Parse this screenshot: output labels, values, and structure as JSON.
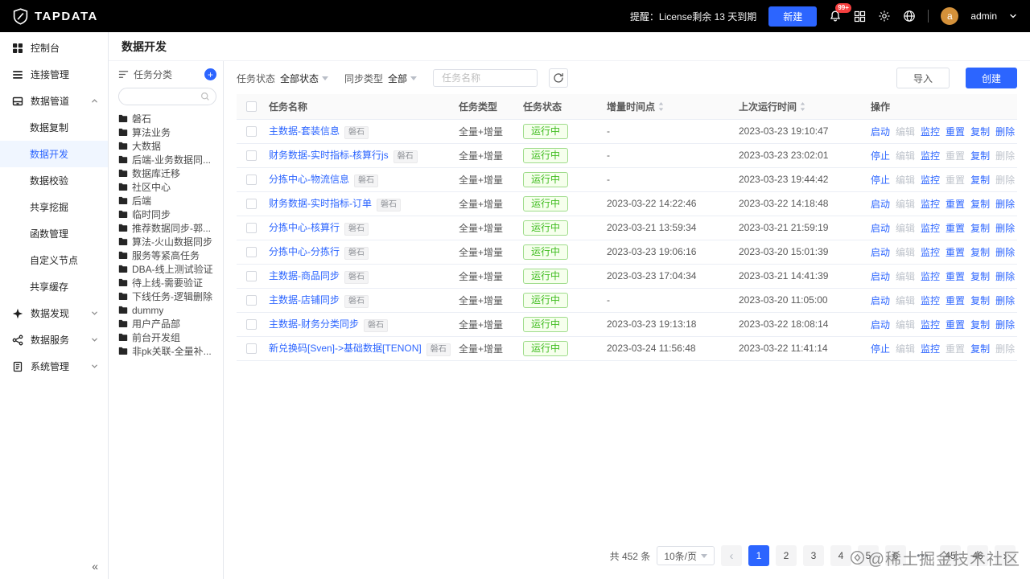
{
  "topbar": {
    "brand": "TAPDATA",
    "license_notice": "提醒：License剩余 13 天到期",
    "new_button": "新建",
    "notification_count": "99+",
    "username": "admin",
    "avatar_letter": "a"
  },
  "colors": {
    "primary": "#2c65ff",
    "success": "#3fbc1f",
    "topbar_bg": "#000000",
    "avatar_bg": "#d4913a",
    "notification_badge_bg": "#f53f3f"
  },
  "page": {
    "title": "数据开发"
  },
  "sidebar": {
    "collapse_icon": "«",
    "items": [
      {
        "id": "console",
        "label": "控制台",
        "icon": "dashboard-icon"
      },
      {
        "id": "connections",
        "label": "连接管理",
        "icon": "connections-icon"
      },
      {
        "id": "data-pipeline",
        "label": "数据管道",
        "icon": "pipeline-icon",
        "expanded": true,
        "children": [
          {
            "id": "data-replication",
            "label": "数据复制"
          },
          {
            "id": "data-development",
            "label": "数据开发",
            "active": true
          },
          {
            "id": "data-validation",
            "label": "数据校验"
          },
          {
            "id": "shared-mining",
            "label": "共享挖掘"
          },
          {
            "id": "function-management",
            "label": "函数管理"
          },
          {
            "id": "custom-node",
            "label": "自定义节点"
          },
          {
            "id": "shared-cache",
            "label": "共享缓存"
          }
        ]
      },
      {
        "id": "data-discovery",
        "label": "数据发现",
        "icon": "discovery-icon",
        "expandable": true
      },
      {
        "id": "data-service",
        "label": "数据服务",
        "icon": "services-icon",
        "expandable": true
      },
      {
        "id": "system-management",
        "label": "系统管理",
        "icon": "system-icon",
        "expandable": true
      }
    ]
  },
  "tree_panel": {
    "title": "任务分类",
    "search_placeholder": "",
    "items": [
      "磐石",
      "算法业务",
      "大数据",
      "后端-业务数据同...",
      "数据库迁移",
      "社区中心",
      "后端",
      "临时同步",
      "推荐数据同步-郭...",
      "算法-火山数据同步",
      "服务等紧高任务",
      "DBA-线上测试验证",
      "待上线-需要验证",
      "下线任务-逻辑删除",
      "dummy",
      "用户产品部",
      "前台开发组",
      "非pk关联-全量补..."
    ]
  },
  "filters": {
    "status_label": "任务状态",
    "status_value": "全部状态",
    "sync_type_label": "同步类型",
    "sync_type_value": "全部",
    "search_placeholder": "任务名称"
  },
  "actions": {
    "import": "导入",
    "create": "创建"
  },
  "table": {
    "columns": [
      {
        "label": "任务名称"
      },
      {
        "label": "任务类型"
      },
      {
        "label": "任务状态"
      },
      {
        "label": "增量时间点",
        "sortable": true
      },
      {
        "label": "上次运行时间",
        "sortable": true
      },
      {
        "label": "操作"
      }
    ],
    "rows": [
      {
        "name": "主数据-套装信息",
        "tag": "磐石",
        "type": "全量+增量",
        "status": "运行中",
        "increment_time": "-",
        "last_run_time": "2023-03-23 19:10:47",
        "ops": [
          {
            "id": "start",
            "label": "启动",
            "enabled": true
          },
          {
            "id": "edit",
            "label": "编辑",
            "enabled": false
          },
          {
            "id": "monitor",
            "label": "监控",
            "enabled": true
          },
          {
            "id": "reset",
            "label": "重置",
            "enabled": true
          },
          {
            "id": "copy",
            "label": "复制",
            "enabled": true
          },
          {
            "id": "delete",
            "label": "删除",
            "enabled": true
          }
        ]
      },
      {
        "name": "财务数据-实时指标-核算行js",
        "tag": "磐石",
        "type": "全量+增量",
        "status": "运行中",
        "increment_time": "-",
        "last_run_time": "2023-03-23 23:02:01",
        "ops": [
          {
            "id": "stop",
            "label": "停止",
            "enabled": true
          },
          {
            "id": "edit",
            "label": "编辑",
            "enabled": false
          },
          {
            "id": "monitor",
            "label": "监控",
            "enabled": true
          },
          {
            "id": "reset",
            "label": "重置",
            "enabled": false
          },
          {
            "id": "copy",
            "label": "复制",
            "enabled": true
          },
          {
            "id": "delete",
            "label": "删除",
            "enabled": false
          }
        ]
      },
      {
        "name": "分拣中心-物流信息",
        "tag": "磐石",
        "type": "全量+增量",
        "status": "运行中",
        "increment_time": "-",
        "last_run_time": "2023-03-23 19:44:42",
        "ops": [
          {
            "id": "stop",
            "label": "停止",
            "enabled": true
          },
          {
            "id": "edit",
            "label": "编辑",
            "enabled": false
          },
          {
            "id": "monitor",
            "label": "监控",
            "enabled": true
          },
          {
            "id": "reset",
            "label": "重置",
            "enabled": false
          },
          {
            "id": "copy",
            "label": "复制",
            "enabled": true
          },
          {
            "id": "delete",
            "label": "删除",
            "enabled": false
          }
        ]
      },
      {
        "name": "财务数据-实时指标-订单",
        "tag": "磐石",
        "type": "全量+增量",
        "status": "运行中",
        "increment_time": "2023-03-22 14:22:46",
        "last_run_time": "2023-03-22 14:18:48",
        "ops": [
          {
            "id": "start",
            "label": "启动",
            "enabled": true
          },
          {
            "id": "edit",
            "label": "编辑",
            "enabled": false
          },
          {
            "id": "monitor",
            "label": "监控",
            "enabled": true
          },
          {
            "id": "reset",
            "label": "重置",
            "enabled": true
          },
          {
            "id": "copy",
            "label": "复制",
            "enabled": true
          },
          {
            "id": "delete",
            "label": "删除",
            "enabled": true
          }
        ]
      },
      {
        "name": "分拣中心-核算行",
        "tag": "磐石",
        "type": "全量+增量",
        "status": "运行中",
        "increment_time": "2023-03-21 13:59:34",
        "last_run_time": "2023-03-21 21:59:19",
        "ops": [
          {
            "id": "start",
            "label": "启动",
            "enabled": true
          },
          {
            "id": "edit",
            "label": "编辑",
            "enabled": false
          },
          {
            "id": "monitor",
            "label": "监控",
            "enabled": true
          },
          {
            "id": "reset",
            "label": "重置",
            "enabled": true
          },
          {
            "id": "copy",
            "label": "复制",
            "enabled": true
          },
          {
            "id": "delete",
            "label": "删除",
            "enabled": true
          }
        ]
      },
      {
        "name": "分拣中心-分拣行",
        "tag": "磐石",
        "type": "全量+增量",
        "status": "运行中",
        "increment_time": "2023-03-23 19:06:16",
        "last_run_time": "2023-03-20 15:01:39",
        "ops": [
          {
            "id": "start",
            "label": "启动",
            "enabled": true
          },
          {
            "id": "edit",
            "label": "编辑",
            "enabled": false
          },
          {
            "id": "monitor",
            "label": "监控",
            "enabled": true
          },
          {
            "id": "reset",
            "label": "重置",
            "enabled": true
          },
          {
            "id": "copy",
            "label": "复制",
            "enabled": true
          },
          {
            "id": "delete",
            "label": "删除",
            "enabled": true
          }
        ]
      },
      {
        "name": "主数据-商品同步",
        "tag": "磐石",
        "type": "全量+增量",
        "status": "运行中",
        "increment_time": "2023-03-23 17:04:34",
        "last_run_time": "2023-03-21 14:41:39",
        "ops": [
          {
            "id": "start",
            "label": "启动",
            "enabled": true
          },
          {
            "id": "edit",
            "label": "编辑",
            "enabled": false
          },
          {
            "id": "monitor",
            "label": "监控",
            "enabled": true
          },
          {
            "id": "reset",
            "label": "重置",
            "enabled": true
          },
          {
            "id": "copy",
            "label": "复制",
            "enabled": true
          },
          {
            "id": "delete",
            "label": "删除",
            "enabled": true
          }
        ]
      },
      {
        "name": "主数据-店铺同步",
        "tag": "磐石",
        "type": "全量+增量",
        "status": "运行中",
        "increment_time": "-",
        "last_run_time": "2023-03-20 11:05:00",
        "ops": [
          {
            "id": "start",
            "label": "启动",
            "enabled": true
          },
          {
            "id": "edit",
            "label": "编辑",
            "enabled": false
          },
          {
            "id": "monitor",
            "label": "监控",
            "enabled": true
          },
          {
            "id": "reset",
            "label": "重置",
            "enabled": true
          },
          {
            "id": "copy",
            "label": "复制",
            "enabled": true
          },
          {
            "id": "delete",
            "label": "删除",
            "enabled": true
          }
        ]
      },
      {
        "name": "主数据-财务分类同步",
        "tag": "磐石",
        "type": "全量+增量",
        "status": "运行中",
        "increment_time": "2023-03-23 19:13:18",
        "last_run_time": "2023-03-22 18:08:14",
        "ops": [
          {
            "id": "start",
            "label": "启动",
            "enabled": true
          },
          {
            "id": "edit",
            "label": "编辑",
            "enabled": false
          },
          {
            "id": "monitor",
            "label": "监控",
            "enabled": true
          },
          {
            "id": "reset",
            "label": "重置",
            "enabled": true
          },
          {
            "id": "copy",
            "label": "复制",
            "enabled": true
          },
          {
            "id": "delete",
            "label": "删除",
            "enabled": true
          }
        ]
      },
      {
        "name": "新兑换码[Sven]->基础数据[TENON]",
        "tag": "磐石",
        "type": "全量+增量",
        "status": "运行中",
        "increment_time": "2023-03-24 11:56:48",
        "last_run_time": "2023-03-22 11:41:14",
        "ops": [
          {
            "id": "stop",
            "label": "停止",
            "enabled": true
          },
          {
            "id": "edit",
            "label": "编辑",
            "enabled": false
          },
          {
            "id": "monitor",
            "label": "监控",
            "enabled": true
          },
          {
            "id": "reset",
            "label": "重置",
            "enabled": false
          },
          {
            "id": "copy",
            "label": "复制",
            "enabled": true
          },
          {
            "id": "delete",
            "label": "删除",
            "enabled": false
          }
        ]
      }
    ]
  },
  "pagination": {
    "total": "共 452 条",
    "page_size": "10条/页",
    "prev": "‹",
    "next": "›",
    "pages": [
      "1",
      "2",
      "3",
      "4",
      "5",
      "6",
      "•••",
      "45",
      "46"
    ],
    "active_page": "1"
  },
  "watermark": "@稀土掘金技术社区"
}
